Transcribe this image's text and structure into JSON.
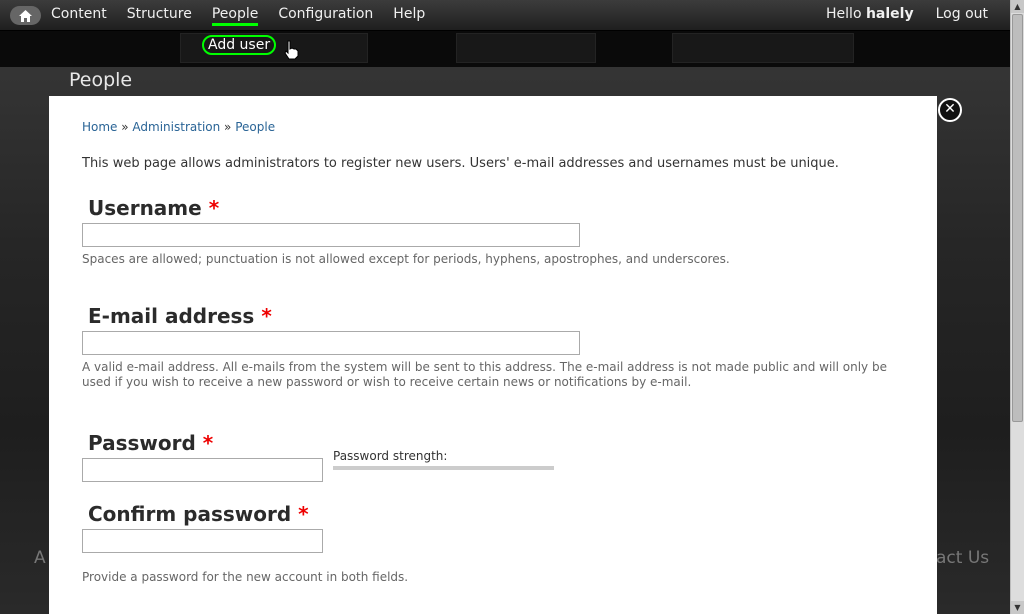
{
  "toolbar": {
    "nav": [
      "Content",
      "Structure",
      "People",
      "Configuration",
      "Help"
    ],
    "active": "People",
    "hello_prefix": "Hello ",
    "username": "halely",
    "logout": "Log out"
  },
  "shortcut": {
    "label": "Add user"
  },
  "background": {
    "page_title": "People",
    "footer_left": "A",
    "footer_right": "act Us"
  },
  "overlay": {
    "breadcrumb": {
      "home": "Home",
      "sep": " » ",
      "admin": "Administration",
      "people": "People"
    },
    "intro": "This web page allows administrators to register new users. Users' e-mail addresses and usernames must be unique.",
    "username": {
      "label": "Username",
      "required": "*",
      "value": "",
      "desc": "Spaces are allowed; punctuation is not allowed except for periods, hyphens, apostrophes, and underscores."
    },
    "email": {
      "label": "E-mail address",
      "required": "*",
      "value": "",
      "desc": "A valid e-mail address. All e-mails from the system will be sent to this address. The e-mail address is not made public and will only be used if you wish to receive a new password or wish to receive certain news or notifications by e-mail."
    },
    "password": {
      "label": "Password",
      "required": "*",
      "value": "",
      "strength": "Password strength:"
    },
    "confirm": {
      "label": "Confirm password",
      "required": "*",
      "value": "",
      "desc": "Provide a password for the new account in both fields."
    },
    "close": "✕"
  }
}
